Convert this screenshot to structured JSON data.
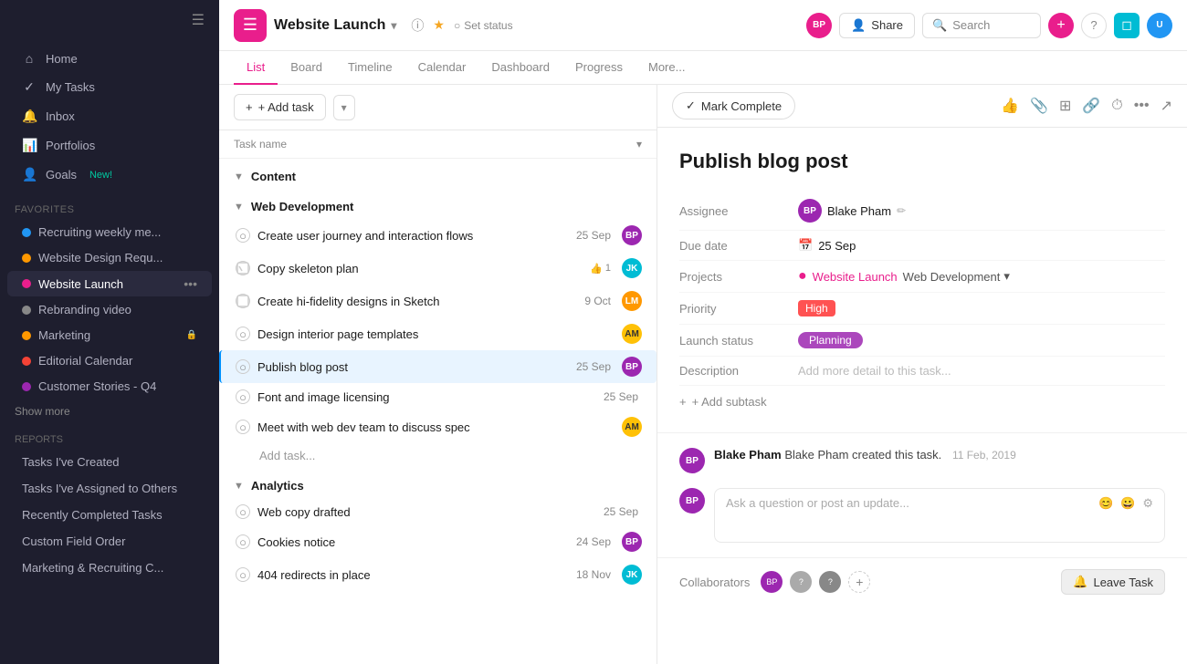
{
  "sidebar": {
    "nav_items": [
      {
        "label": "Home",
        "icon": "⌂",
        "id": "home"
      },
      {
        "label": "My Tasks",
        "icon": "✓",
        "id": "my-tasks"
      },
      {
        "label": "Inbox",
        "icon": "🔔",
        "id": "inbox"
      },
      {
        "label": "Portfolios",
        "icon": "📊",
        "id": "portfolios"
      },
      {
        "label": "Goals",
        "icon": "👤",
        "id": "goals",
        "badge": "New!"
      }
    ],
    "favorites_label": "Favorites",
    "favorites": [
      {
        "label": "Recruiting weekly me...",
        "color": "#2196f3",
        "id": "fav-1"
      },
      {
        "label": "Website Design Requ...",
        "color": "#ff9800",
        "id": "fav-2"
      },
      {
        "label": "Website Launch",
        "color": "#e91e8c",
        "id": "fav-3",
        "active": true
      },
      {
        "label": "Rebranding video",
        "color": "#888",
        "id": "fav-4"
      },
      {
        "label": "Marketing",
        "color": "#ff9800",
        "id": "fav-5",
        "lock": true
      },
      {
        "label": "Editorial Calendar",
        "color": "#f44336",
        "id": "fav-6"
      },
      {
        "label": "Customer Stories - Q4",
        "color": "#9c27b0",
        "id": "fav-7"
      }
    ],
    "show_more": "Show more",
    "reports_label": "Reports",
    "reports": [
      {
        "label": "Tasks I've Created",
        "id": "rep-1"
      },
      {
        "label": "Tasks I've Assigned to Others",
        "id": "rep-2"
      },
      {
        "label": "Recently Completed Tasks",
        "id": "rep-3"
      },
      {
        "label": "Custom Field Order",
        "id": "rep-4"
      },
      {
        "label": "Marketing & Recruiting C...",
        "id": "rep-5"
      }
    ]
  },
  "header": {
    "project_title": "Website Launch",
    "set_status": "Set status",
    "share_label": "Share",
    "search_placeholder": "Search"
  },
  "tabs": [
    {
      "label": "List",
      "active": true
    },
    {
      "label": "Board"
    },
    {
      "label": "Timeline"
    },
    {
      "label": "Calendar"
    },
    {
      "label": "Dashboard"
    },
    {
      "label": "Progress"
    },
    {
      "label": "More..."
    }
  ],
  "task_list": {
    "add_task_label": "+ Add task",
    "column_task_name": "Task name",
    "sections": [
      {
        "name": "Content",
        "tasks": []
      },
      {
        "name": "Web Development",
        "tasks": [
          {
            "name": "Create user journey and interaction flows",
            "date": "25 Sep",
            "avatar_color": "#9c27b0",
            "avatar_initials": "BP",
            "check": false,
            "template": false
          },
          {
            "name": "Copy skeleton plan",
            "date": "",
            "avatar_color": "#00bcd4",
            "avatar_initials": "JK",
            "check": false,
            "template": true,
            "likes": "1"
          },
          {
            "name": "Create hi-fidelity designs in Sketch",
            "date": "9 Oct",
            "avatar_color": "#ff9800",
            "avatar_initials": "LM",
            "check": false,
            "template": true
          },
          {
            "name": "Design interior page templates",
            "date": "",
            "avatar_color": "#ffc107",
            "avatar_initials": "AM",
            "check": false,
            "template": false
          },
          {
            "name": "Publish blog post",
            "date": "25 Sep",
            "avatar_color": "#9c27b0",
            "avatar_initials": "BP",
            "check": false,
            "template": false,
            "selected": true
          },
          {
            "name": "Font and image licensing",
            "date": "25 Sep",
            "avatar_color": null,
            "avatar_initials": "",
            "check": false,
            "template": false
          },
          {
            "name": "Meet with web dev team to discuss spec",
            "date": "",
            "avatar_color": "#ffc107",
            "avatar_initials": "AM",
            "check": false,
            "template": false
          }
        ],
        "add_task_placeholder": "Add task..."
      },
      {
        "name": "Analytics",
        "tasks": [
          {
            "name": "Web copy drafted",
            "date": "25 Sep",
            "avatar_color": null,
            "avatar_initials": "",
            "check": false,
            "template": false
          },
          {
            "name": "Cookies notice",
            "date": "24 Sep",
            "avatar_color": "#9c27b0",
            "avatar_initials": "BP",
            "check": false,
            "template": false
          },
          {
            "name": "404 redirects in place",
            "date": "18 Nov",
            "avatar_color": "#00bcd4",
            "avatar_initials": "JK",
            "check": false,
            "template": false
          }
        ]
      }
    ]
  },
  "detail_panel": {
    "mark_complete": "Mark Complete",
    "task_title": "Publish blog post",
    "assignee_label": "Assignee",
    "assignee_name": "Blake Pham",
    "due_date_label": "Due date",
    "due_date": "25 Sep",
    "projects_label": "Projects",
    "project_name": "Website Launch",
    "project_tag": "Web Development",
    "priority_label": "Priority",
    "priority": "High",
    "launch_status_label": "Launch status",
    "launch_status": "Planning",
    "description_label": "Description",
    "description_placeholder": "Add more detail to this task...",
    "add_subtask": "+ Add subtask",
    "comment_activity": "Blake Pham created this task.",
    "comment_date": "11 Feb, 2019",
    "comment_input_placeholder": "Ask a question or post an update...",
    "collaborators_label": "Collaborators",
    "leave_task": "Leave Task"
  }
}
